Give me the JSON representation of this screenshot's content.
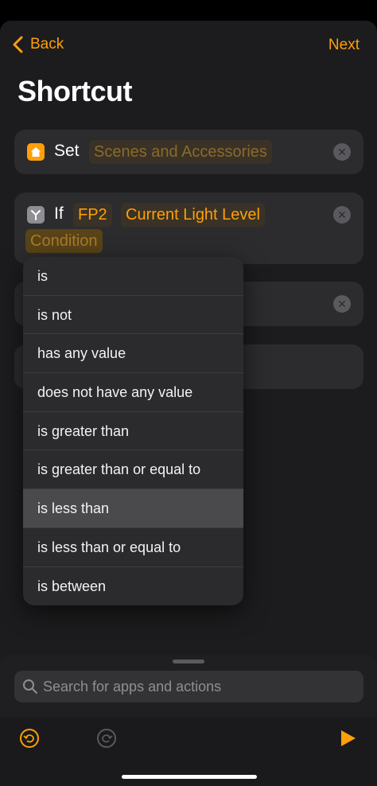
{
  "nav": {
    "back_label": "Back",
    "next_label": "Next",
    "title": "Shortcut"
  },
  "actions": {
    "set": {
      "verb": "Set",
      "param": "Scenes and Accessories"
    },
    "if": {
      "verb": "If",
      "param1": "FP2",
      "param2": "Current Light Level",
      "param3": "Condition"
    }
  },
  "menu": {
    "items": [
      "is",
      "is not",
      "has any value",
      "does not have any value",
      "is greater than",
      "is greater than or equal to",
      "is less than",
      "is less than or equal to",
      "is between"
    ],
    "selected": "is less than"
  },
  "search": {
    "placeholder": "Search for apps and actions"
  },
  "colors": {
    "accent": "#ff9f0a",
    "background": "#1c1c1e",
    "card": "#2c2c2e"
  },
  "icons": [
    "chevron-left-icon",
    "home-icon",
    "if-icon",
    "clear-icon",
    "search-icon",
    "undo-icon",
    "redo-icon",
    "play-icon"
  ]
}
